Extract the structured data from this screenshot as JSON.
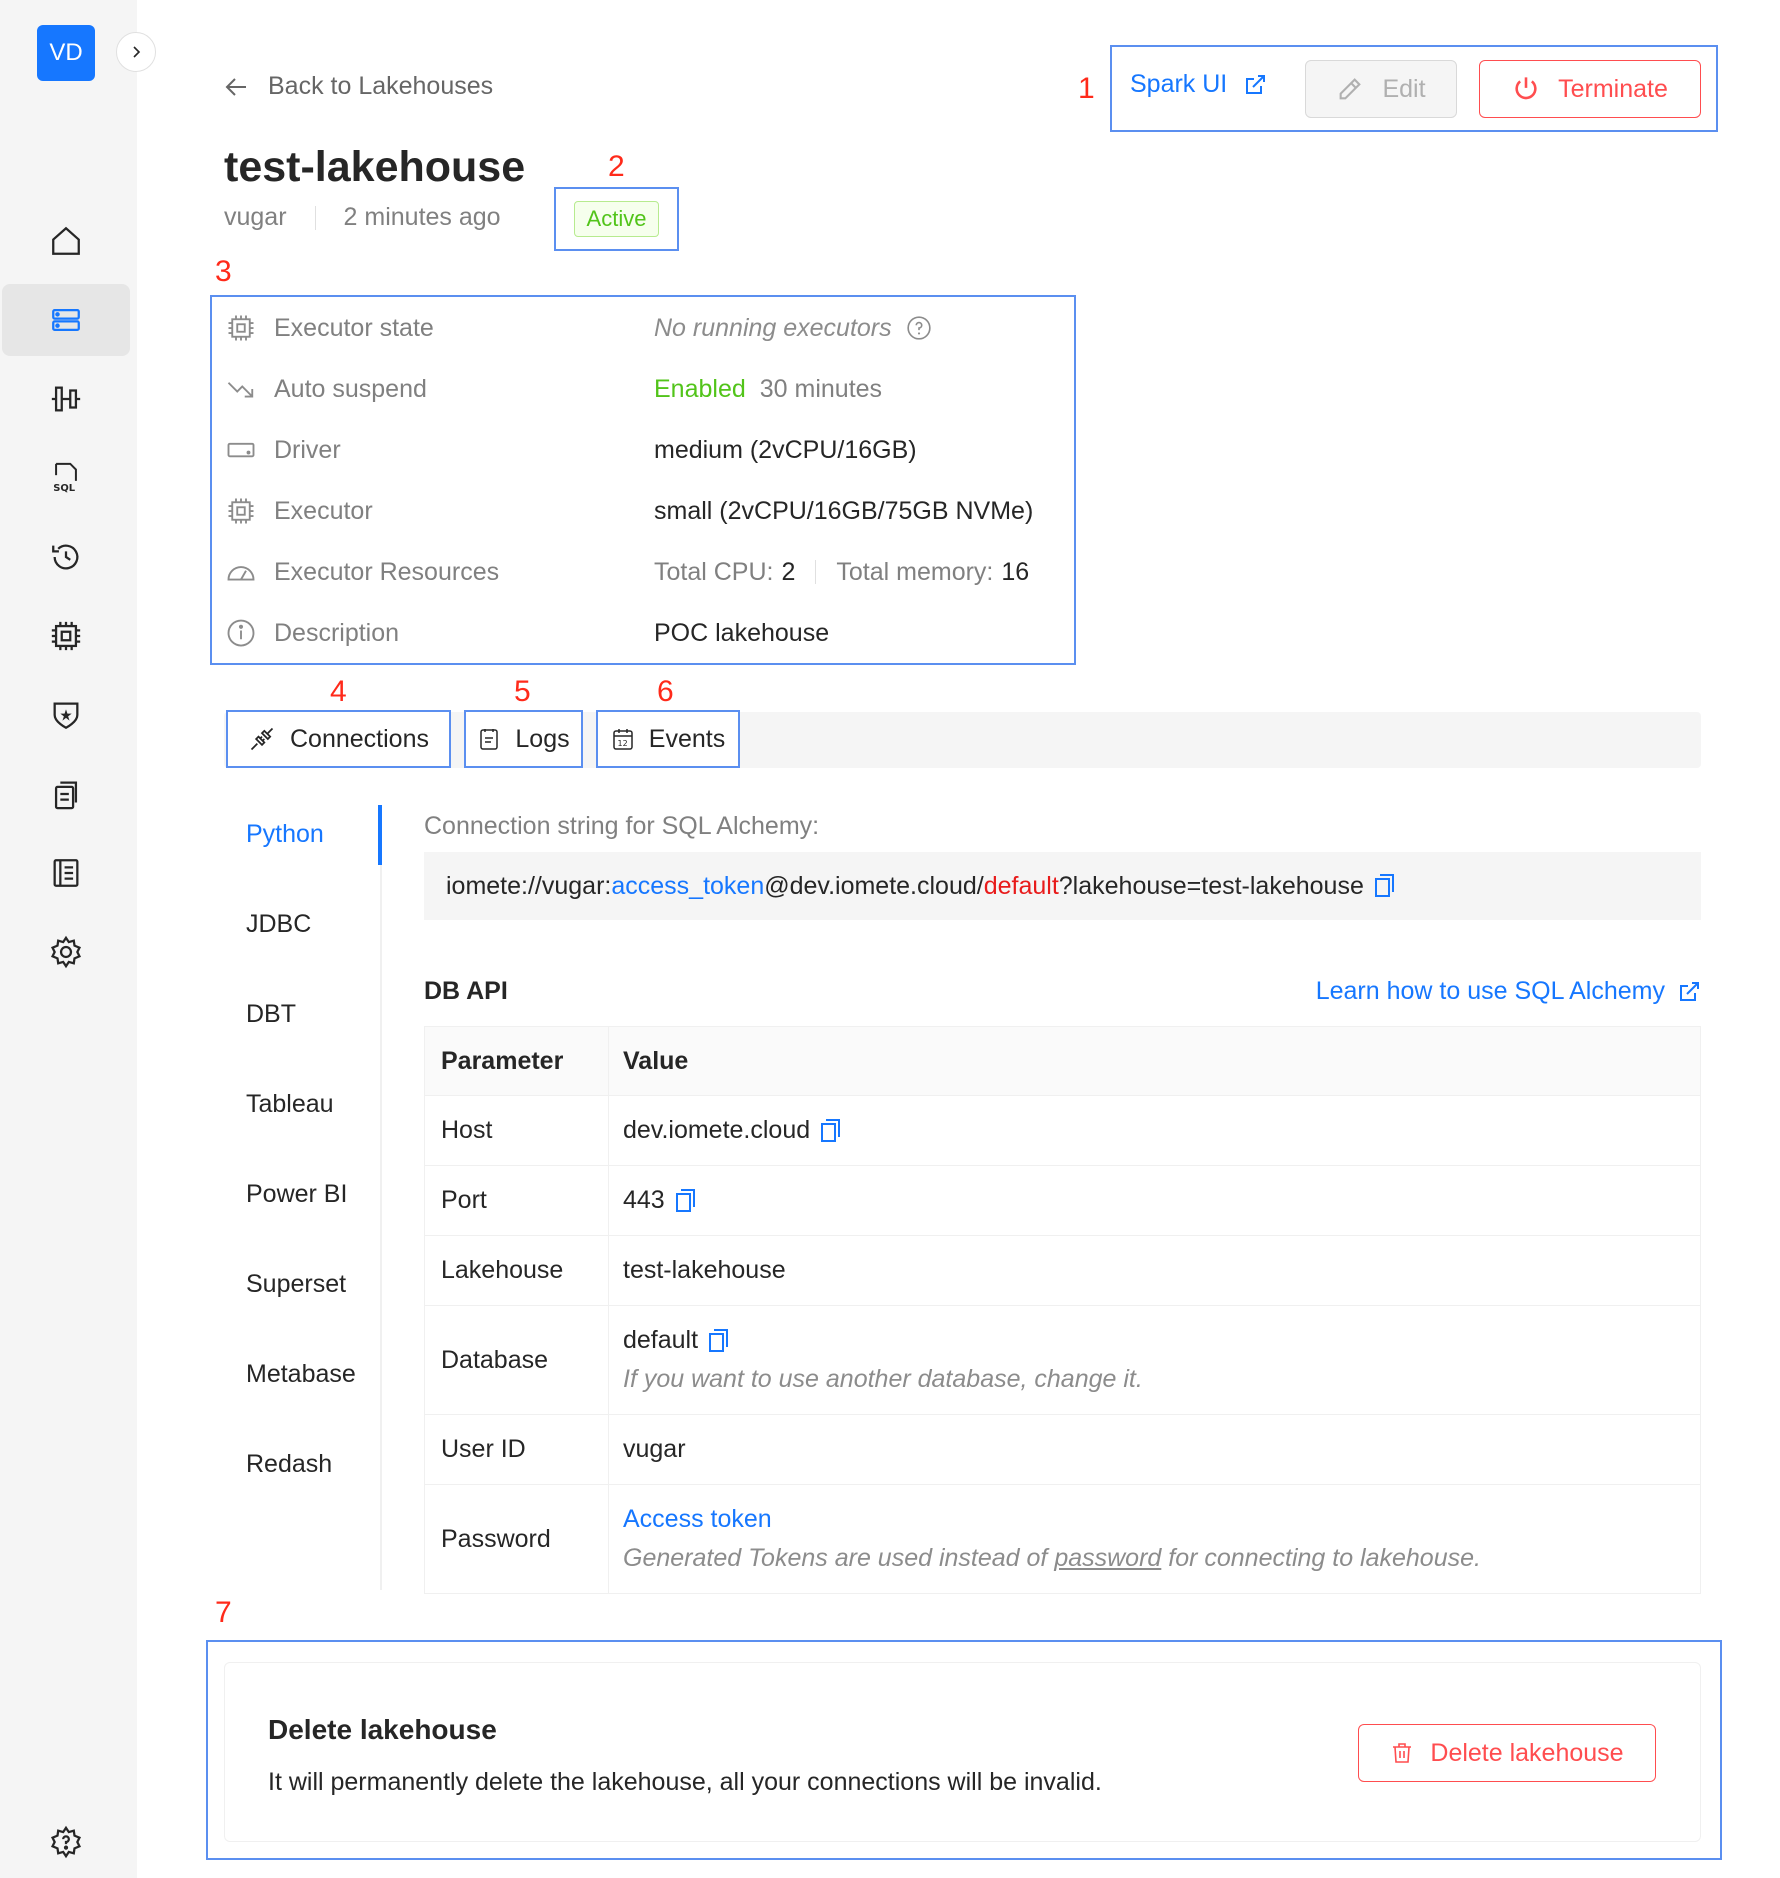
{
  "sidebar": {
    "avatar_initials": "VD",
    "nav": [
      {
        "icon": "home-icon",
        "active": false
      },
      {
        "icon": "lakehouse-icon",
        "active": true
      },
      {
        "icon": "spark-jobs-icon",
        "active": false
      },
      {
        "icon": "sql-editor-icon",
        "active": false
      },
      {
        "icon": "history-icon",
        "active": false
      },
      {
        "icon": "chip-icon",
        "active": false
      },
      {
        "icon": "security-shield-icon",
        "active": false
      },
      {
        "icon": "documents-icon",
        "active": false
      },
      {
        "icon": "catalog-icon",
        "active": false
      },
      {
        "icon": "settings-gear-icon",
        "active": false
      },
      {
        "icon": "help-icon",
        "active": false
      }
    ]
  },
  "header": {
    "back_label": "Back to Lakehouses",
    "title": "test-lakehouse",
    "owner": "vugar",
    "created": "2 minutes ago",
    "status": "Active"
  },
  "actions": {
    "spark_ui": "Spark UI",
    "edit": "Edit",
    "terminate": "Terminate"
  },
  "annotations": [
    "1",
    "2",
    "3",
    "4",
    "5",
    "6",
    "7"
  ],
  "details": {
    "executor_state": {
      "label": "Executor state",
      "value": "No running executors"
    },
    "auto_suspend": {
      "label": "Auto suspend",
      "value_status": "Enabled",
      "value_duration": "30 minutes"
    },
    "driver": {
      "label": "Driver",
      "value": "medium (2vCPU/16GB)"
    },
    "executor": {
      "label": "Executor",
      "value": "small (2vCPU/16GB/75GB NVMe)"
    },
    "executor_resources": {
      "label": "Executor Resources",
      "cpu_label": "Total CPU:",
      "cpu_value": "2",
      "memory_label": "Total memory:",
      "memory_value": "16"
    },
    "description": {
      "label": "Description",
      "value": "POC lakehouse"
    }
  },
  "tabs": {
    "connections": "Connections",
    "logs": "Logs",
    "events": "Events"
  },
  "connection_menu": [
    "Python",
    "JDBC",
    "DBT",
    "Tableau",
    "Power BI",
    "Superset",
    "Metabase",
    "Redash"
  ],
  "python": {
    "conn_label": "Connection string for SQL Alchemy:",
    "conn_prefix": "iomete://vugar:",
    "conn_token": "access_token",
    "conn_host": "@dev.iomete.cloud/",
    "conn_db": "default",
    "conn_suffix": "?lakehouse=test-lakehouse",
    "dbapi_title": "DB API",
    "learn_link": "Learn how to use SQL Alchemy",
    "table_headers": {
      "param": "Parameter",
      "value": "Value"
    },
    "rows": {
      "host": {
        "param": "Host",
        "value": "dev.iomete.cloud"
      },
      "port": {
        "param": "Port",
        "value": "443"
      },
      "lakehouse": {
        "param": "Lakehouse",
        "value": "test-lakehouse"
      },
      "database": {
        "param": "Database",
        "value": "default",
        "hint": "If you want to use another database, change it."
      },
      "user": {
        "param": "User ID",
        "value": "vugar"
      },
      "password": {
        "param": "Password",
        "link": "Access token",
        "hint_before": "Generated Tokens are used instead of ",
        "hint_link": "password",
        "hint_after": " for connecting to lakehouse."
      }
    }
  },
  "delete": {
    "title": "Delete lakehouse",
    "description": "It will permanently delete the lakehouse, all your connections will be invalid.",
    "button": "Delete lakehouse"
  },
  "colors": {
    "primary": "#1677ff",
    "danger": "#ff4d4f",
    "success": "#52c41a",
    "annotation": "#ff2a1a",
    "annotation_box": "#5b8ff0"
  }
}
